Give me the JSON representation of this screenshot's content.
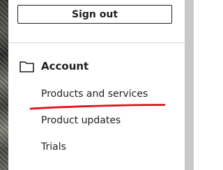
{
  "menu": {
    "sign_out_label": "Sign out",
    "section": {
      "icon": "folder-icon",
      "title": "Account"
    },
    "links": [
      {
        "label": "Products and services",
        "underlined": true
      },
      {
        "label": "Product updates"
      },
      {
        "label": "Trials"
      }
    ]
  },
  "colors": {
    "annotation_underline": "#e0141e",
    "scrollbar": "#c8c8c8",
    "text": "#1f1f1f"
  }
}
